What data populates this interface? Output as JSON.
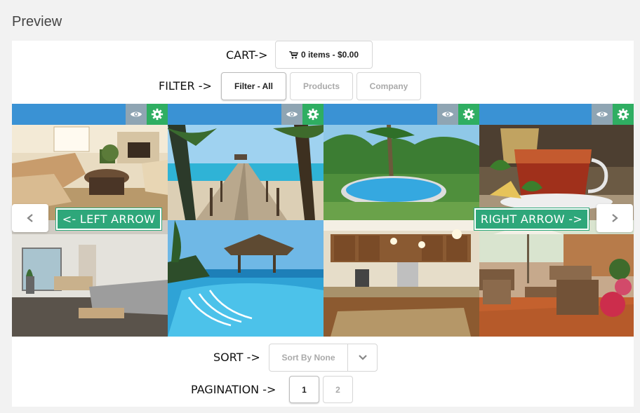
{
  "page_title": "Preview",
  "cart": {
    "label": "CART->",
    "button_text": "0 items - $0.00",
    "icon": "shopping-cart-icon"
  },
  "filter": {
    "label": "FILTER ->",
    "buttons": [
      "Filter - All",
      "Products",
      "Company"
    ],
    "active": "Filter - All"
  },
  "toolbar": {
    "icons": [
      "eye-icon",
      "gear-icon"
    ],
    "bar_color": "#3a92d4",
    "eye_color": "#8fa5b3",
    "gear_color": "#2fae62"
  },
  "gallery": {
    "images": [
      "living-room",
      "tropical-pier",
      "garden-pool",
      "tea-cup",
      "modern-living-room",
      "overwater-pool",
      "kitchen",
      "outdoor-patio"
    ]
  },
  "arrows": {
    "left_callout": "<- LEFT ARROW",
    "right_callout": "RIGHT ARROW ->",
    "left_icon": "chevron-left-icon",
    "right_icon": "chevron-right-icon",
    "callout_color": "#2ea77a"
  },
  "sort": {
    "label": "SORT ->",
    "value": "Sort By None",
    "icon": "chevron-down-icon"
  },
  "pagination": {
    "label": "PAGINATION ->",
    "pages": [
      "1",
      "2"
    ],
    "active": "1"
  }
}
